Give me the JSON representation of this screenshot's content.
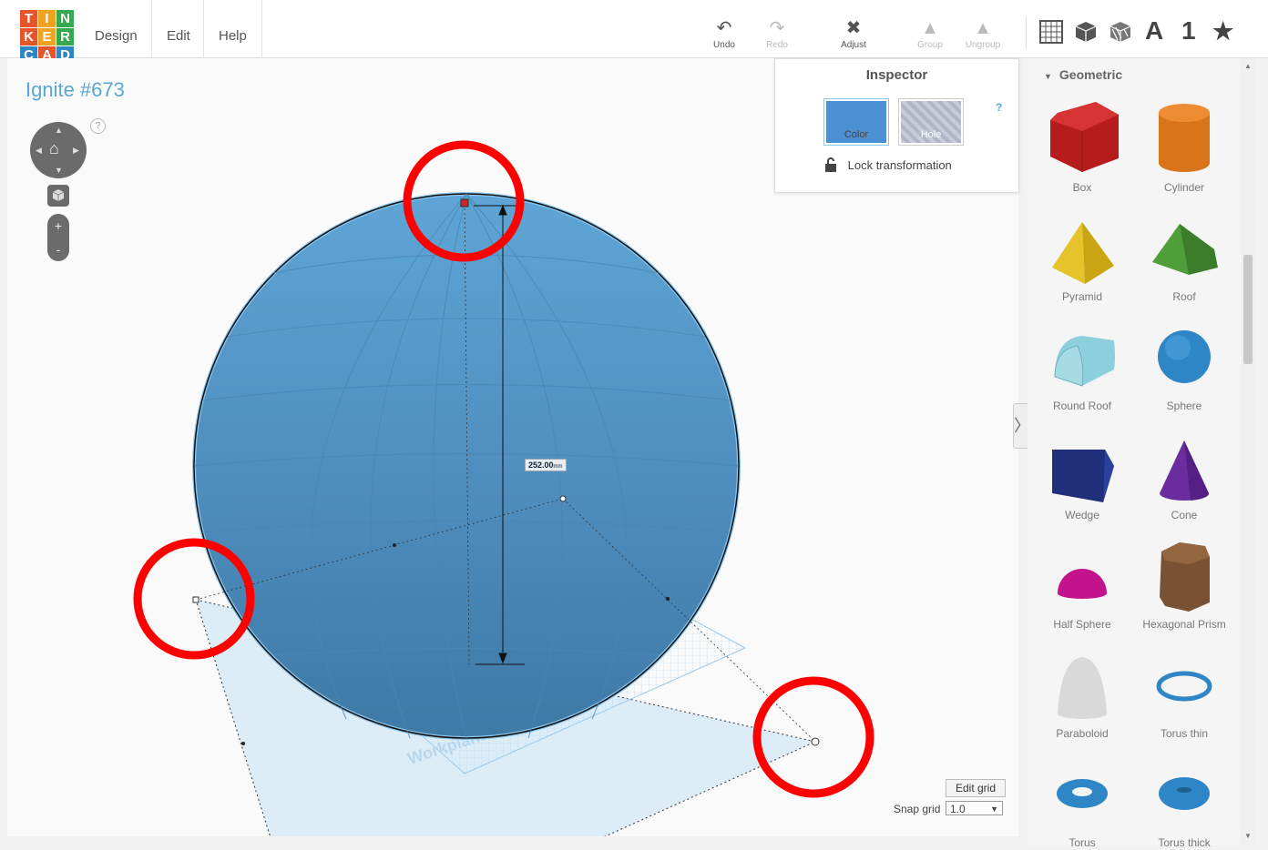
{
  "logo": {
    "letters": [
      "T",
      "I",
      "N",
      "K",
      "E",
      "R",
      "C",
      "A",
      "D"
    ],
    "colors": [
      "#e8552a",
      "#f0a323",
      "#37a852",
      "#e8552a",
      "#f0a323",
      "#37a852",
      "#2f86c6",
      "#e8552a",
      "#2f86c6"
    ]
  },
  "menu": {
    "items": [
      "Design",
      "Edit",
      "Help"
    ]
  },
  "toolbar": {
    "undo": "Undo",
    "redo": "Redo",
    "adjust": "Adjust",
    "group": "Group",
    "ungroup": "Ungroup"
  },
  "view_icons": {
    "grid": "grid-icon",
    "box": "box-icon",
    "hatched": "hatched-box-icon",
    "text": "A",
    "number": "1",
    "star": "star-icon"
  },
  "design": {
    "title": "Ignite #673"
  },
  "nav": {
    "help": "?"
  },
  "inspector": {
    "title": "Inspector",
    "color_label": "Color",
    "hole_label": "Hole",
    "help": "?",
    "lock_label": "Lock transformation",
    "color": "#4a90d2"
  },
  "measurement": {
    "value": "252.00",
    "unit": "mm"
  },
  "sidebar": {
    "heading": "Geometric",
    "shapes": [
      {
        "label": "Box"
      },
      {
        "label": "Cylinder"
      },
      {
        "label": "Pyramid"
      },
      {
        "label": "Roof"
      },
      {
        "label": "Round Roof"
      },
      {
        "label": "Sphere"
      },
      {
        "label": "Wedge"
      },
      {
        "label": "Cone"
      },
      {
        "label": "Half Sphere"
      },
      {
        "label": "Hexagonal Prism"
      },
      {
        "label": "Paraboloid"
      },
      {
        "label": "Torus thin"
      },
      {
        "label": "Torus"
      },
      {
        "label": "Torus thick"
      }
    ]
  },
  "grid": {
    "edit_label": "Edit grid",
    "snap_label": "Snap grid",
    "snap_value": "1.0"
  },
  "workplane": {
    "label": "Workplane"
  }
}
